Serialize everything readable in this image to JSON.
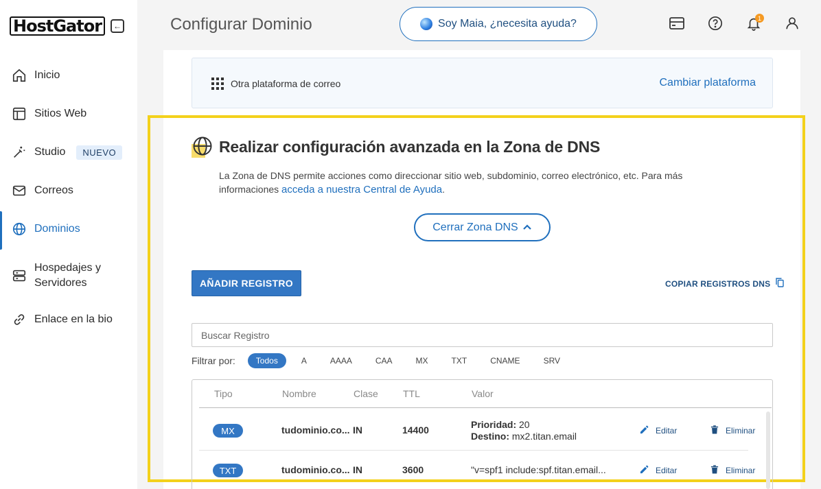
{
  "brand": {
    "logo_text": "HostGator"
  },
  "sidebar": {
    "items": [
      {
        "label": "Inicio",
        "icon": "home-icon"
      },
      {
        "label": "Sitios Web",
        "icon": "browser-icon"
      },
      {
        "label": "Studio",
        "icon": "magic-wand-icon",
        "badge": "NUEVO"
      },
      {
        "label": "Correos",
        "icon": "mail-icon"
      },
      {
        "label": "Dominios",
        "icon": "globe-icon",
        "active": true
      },
      {
        "label_line1": "Hospedajes y",
        "label_line2": "Servidores",
        "icon": "server-icon"
      },
      {
        "label": "Enlace en la bio",
        "icon": "link-icon"
      }
    ]
  },
  "header": {
    "title": "Configurar Dominio",
    "assistant_label": "Soy Maia, ¿necesita ayuda?",
    "notification_count": "1"
  },
  "platform": {
    "label": "Otra plataforma de correo",
    "change_label": "Cambiar plataforma"
  },
  "dns": {
    "title": "Realizar configuración avanzada en la Zona de DNS",
    "description": "La Zona de DNS permite acciones como direccionar sitio web, subdominio, correo electrónico, etc. Para más informaciones",
    "help_link": "acceda a nuestra Central de Ayuda",
    "close_zone_label": "Cerrar Zona DNS",
    "add_record_label": "AÑADIR REGISTRO",
    "copy_records_label": "COPIAR REGISTROS DNS",
    "search_placeholder": "Buscar Registro",
    "filter_label": "Filtrar por:",
    "filters": [
      "Todos",
      "A",
      "AAAA",
      "CAA",
      "MX",
      "TXT",
      "CNAME",
      "SRV"
    ],
    "columns": [
      "Tipo",
      "Nombre",
      "Clase",
      "TTL",
      "Valor"
    ],
    "rows": [
      {
        "type": "MX",
        "name": "tudominio.co...",
        "class": "IN",
        "ttl": "14400",
        "value_label1": "Prioridad:",
        "value1": "20",
        "value_label2": "Destino:",
        "value2": "mx2.titan.email"
      },
      {
        "type": "TXT",
        "name": "tudominio.co...",
        "class": "IN",
        "ttl": "3600",
        "value": "\"v=spf1 include:spf.titan.email..."
      }
    ],
    "edit_label": "Editar",
    "delete_label": "Eliminar"
  },
  "colors": {
    "accent": "#1f6fbd",
    "highlight": "#f3d11b",
    "pill": "#3377c4"
  }
}
